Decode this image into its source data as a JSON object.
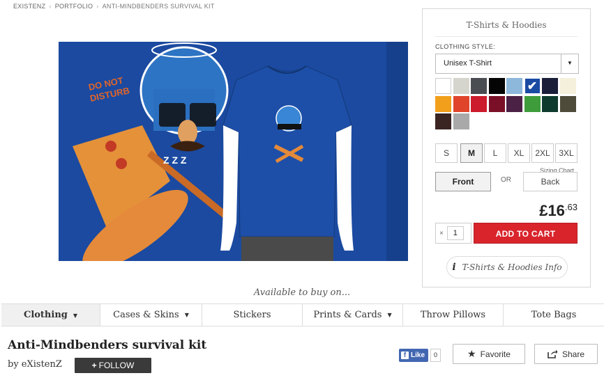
{
  "breadcrumb": [
    "EXISTENZ",
    "PORTFOLIO",
    "ANTI-MINDBENDERS SURVIVAL KIT"
  ],
  "art": {
    "do_not_disturb": "DO NOT DISTURB",
    "zzz": "Z Z Z"
  },
  "panel": {
    "title": "T-Shirts & Hoodies",
    "style_label": "CLOTHING STYLE:",
    "style_value": "Unisex T-Shirt",
    "colors": [
      "#ffffff",
      "#d5d5ce",
      "#4a4d52",
      "#050505",
      "#8db7db",
      "#1a4ba3",
      "#1b1f3a",
      "#f5f0dc",
      "#f2a01b",
      "#e0452b",
      "#cc1b2c",
      "#7a1028",
      "#4b2146",
      "#3f9c3b",
      "#0e3b2e",
      "#4f4b3a",
      "#3a2523",
      "#a9a9a9"
    ],
    "selected_color_index": 5,
    "sizes": [
      "S",
      "M",
      "L",
      "XL",
      "2XL",
      "3XL"
    ],
    "selected_size": "M",
    "sizing_chart": "Sizing Chart",
    "front": "Front",
    "or": "OR",
    "back": "Back",
    "price_main": "£16",
    "price_cents": ".63",
    "qty_x": "×",
    "qty_value": "1",
    "add_to_cart": "ADD TO CART",
    "info_label": "T-Shirts & Hoodies Info"
  },
  "available": "Available to buy on...",
  "tabs": [
    {
      "label": "Clothing",
      "caret": true,
      "active": true
    },
    {
      "label": "Cases & Skins",
      "caret": true,
      "active": false
    },
    {
      "label": "Stickers",
      "caret": false,
      "active": false
    },
    {
      "label": "Prints & Cards",
      "caret": true,
      "active": false
    },
    {
      "label": "Throw Pillows",
      "caret": false,
      "active": false
    },
    {
      "label": "Tote Bags",
      "caret": false,
      "active": false
    }
  ],
  "product": {
    "title": "Anti-Mindbenders survival kit",
    "by": "by eXistenZ",
    "follow": "FOLLOW",
    "fb_like": "Like",
    "fb_count": "0",
    "favorite": "Favorite",
    "share": "Share"
  }
}
